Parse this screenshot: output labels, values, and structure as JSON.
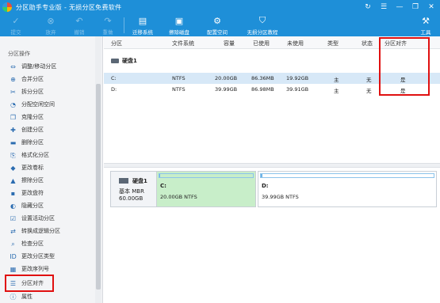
{
  "window": {
    "title": "分区助手专业版 - 无损分区免费软件",
    "controls": [
      "↻",
      "☰",
      "—",
      "❐",
      "✕"
    ]
  },
  "toolbar": {
    "items": [
      {
        "label": "提交",
        "icon": "check-circle-icon",
        "enabled": false
      },
      {
        "label": "放弃",
        "icon": "cancel-circle-icon",
        "enabled": false
      },
      {
        "label": "撤销",
        "icon": "undo-icon",
        "enabled": false
      },
      {
        "label": "重做",
        "icon": "redo-icon",
        "enabled": false
      },
      {
        "label": "迁移系统",
        "icon": "migrate-os-icon",
        "enabled": true
      },
      {
        "label": "擦除磁盘",
        "icon": "wipe-disk-icon",
        "enabled": true
      },
      {
        "label": "配置空间",
        "icon": "allocate-space-icon",
        "enabled": true
      },
      {
        "label": "无损分区教程",
        "icon": "shield-icon",
        "enabled": true
      },
      {
        "label": "工具",
        "icon": "tools-icon",
        "enabled": true
      }
    ]
  },
  "sidebar": {
    "section_title": "分区操作",
    "items": [
      {
        "label": "调整/移动分区",
        "icon": "resize-icon"
      },
      {
        "label": "合并分区",
        "icon": "merge-icon"
      },
      {
        "label": "拆分分区",
        "icon": "split-icon"
      },
      {
        "label": "分配空闲空间",
        "icon": "allocate-icon"
      },
      {
        "label": "克隆分区",
        "icon": "clone-icon"
      },
      {
        "label": "创建分区",
        "icon": "create-icon"
      },
      {
        "label": "删除分区",
        "icon": "delete-icon"
      },
      {
        "label": "格式化分区",
        "icon": "format-icon"
      },
      {
        "label": "更改卷标",
        "icon": "label-icon"
      },
      {
        "label": "擦除分区",
        "icon": "wipe-icon"
      },
      {
        "label": "更改盘符",
        "icon": "drive-letter-icon"
      },
      {
        "label": "隐藏分区",
        "icon": "hide-icon"
      },
      {
        "label": "设置活动分区",
        "icon": "active-icon"
      },
      {
        "label": "转换成逻辑分区",
        "icon": "convert-icon"
      },
      {
        "label": "检查分区",
        "icon": "check-icon"
      },
      {
        "label": "更改分区类型",
        "icon": "type-id-icon"
      },
      {
        "label": "更改序列号",
        "icon": "serial-icon"
      },
      {
        "label": "分区对齐",
        "icon": "align-icon"
      },
      {
        "label": "属性",
        "icon": "info-icon"
      }
    ]
  },
  "table": {
    "columns": [
      "分区",
      "文件系统",
      "容量",
      "已使用",
      "未使用",
      "类型",
      "状态",
      "分区对齐"
    ],
    "disk_label": "硬盘1",
    "rows": [
      {
        "partition": "C:",
        "fs": "NTFS",
        "capacity": "20.00GB",
        "used": "86.36MB",
        "free": "19.92GB",
        "type": "主",
        "status": "无",
        "aligned": "是"
      },
      {
        "partition": "D:",
        "fs": "NTFS",
        "capacity": "39.99GB",
        "used": "86.98MB",
        "free": "39.91GB",
        "type": "主",
        "status": "无",
        "aligned": "是"
      }
    ]
  },
  "disk_map": {
    "disk_name": "硬盘1",
    "disk_type": "基本 MBR",
    "disk_size": "60.00GB",
    "partitions": [
      {
        "name": "C:",
        "detail": "20.00GB NTFS",
        "used_fraction": 0.004
      },
      {
        "name": "D:",
        "detail": "39.99GB NTFS",
        "used_fraction": 0.002
      }
    ]
  },
  "colors": {
    "accent": "#1e8fd8",
    "highlight": "#e01010",
    "selected_row": "#d7e8f7",
    "selected_partition": "#c8eec9"
  }
}
